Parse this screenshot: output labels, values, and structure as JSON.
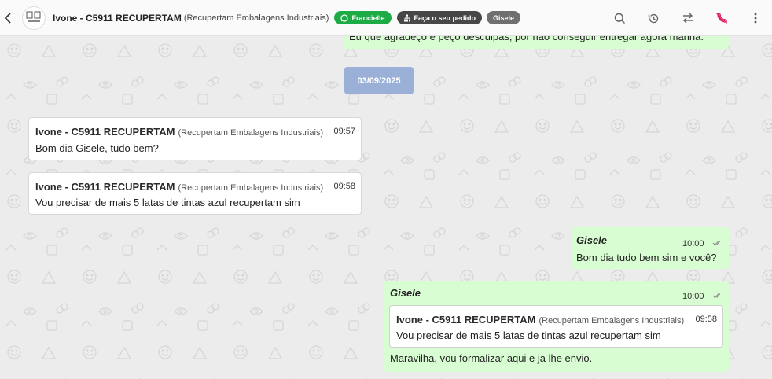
{
  "header": {
    "contact_name": "Ivone - C5911 RECUPERTAM",
    "contact_company": "(Recupertam Embalagens Industriais)",
    "tags": [
      "Francielle",
      "Faça o seu pedido",
      "Gisele"
    ]
  },
  "colors": {
    "tag_whatsapp": "#1dab45",
    "tag_order": "#474747",
    "tag_agent": "#6f6f6f",
    "incoming_bubble": "#ffffff",
    "outgoing_bubble": "#d9fdd3",
    "date_chip": "#9ab0d6",
    "hangup_icon": "#e0245e"
  },
  "chat": {
    "previous_message_text": "Eu que agradeço e peço desculpas, por não conseguir entregar agora manhã.",
    "date_separator": "03/09/2025",
    "messages": [
      {
        "direction": "in",
        "sender": "Ivone - C5911 RECUPERTAM",
        "sender_company": "(Recupertam Embalagens Industriais)",
        "time": "09:57",
        "text": "Bom dia Gisele, tudo bem?"
      },
      {
        "direction": "in",
        "sender": "Ivone - C5911 RECUPERTAM",
        "sender_company": "(Recupertam Embalagens Industriais)",
        "time": "09:58",
        "text": "Vou precisar de mais 5 latas de tintas azul recupertam sim"
      },
      {
        "direction": "out",
        "sender": "Gisele",
        "time": "10:00",
        "text": "Bom dia tudo bem sim e você?"
      },
      {
        "direction": "out",
        "sender": "Gisele",
        "time": "10:00",
        "quoted": {
          "sender": "Ivone - C5911 RECUPERTAM",
          "sender_company": "(Recupertam Embalagens Industriais)",
          "time": "09:58",
          "text": "Vou precisar de mais 5 latas de tintas azul recupertam sim"
        },
        "text": "Maravilha, vou formalizar aqui e ja lhe envio."
      }
    ]
  },
  "icons": [
    "back-icon",
    "avatar-logo",
    "whatsapp-icon",
    "org-icon",
    "search-icon",
    "history-icon",
    "transfer-icon",
    "hangup-icon",
    "more-icon",
    "double-check-icon"
  ]
}
